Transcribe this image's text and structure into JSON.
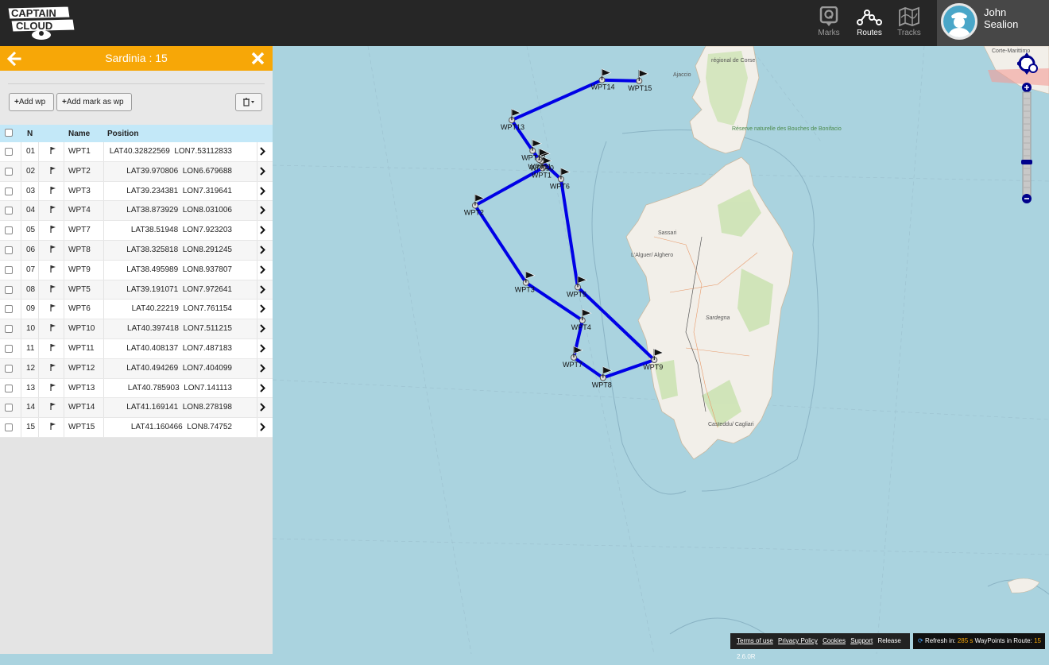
{
  "app": {
    "logo_text": "CAPTAIN CLOUD"
  },
  "nav": [
    {
      "id": "marks",
      "label": "Marks"
    },
    {
      "id": "routes",
      "label": "Routes"
    },
    {
      "id": "tracks",
      "label": "Tracks"
    }
  ],
  "user": {
    "first": "John",
    "last": "Sealion"
  },
  "panel": {
    "title": "Sardinia : 15",
    "add_wp_label": "Add wp",
    "add_mark_label": "Add mark as wp",
    "columns": {
      "n": "N",
      "name": "Name",
      "position": "Position"
    }
  },
  "waypoints": [
    {
      "n": "01",
      "name": "WPT1",
      "lat": "LAT40.32822569",
      "lon": "LON7.53112833"
    },
    {
      "n": "02",
      "name": "WPT2",
      "lat": "LAT39.970806",
      "lon": "LON6.679688"
    },
    {
      "n": "03",
      "name": "WPT3",
      "lat": "LAT39.234381",
      "lon": "LON7.319641"
    },
    {
      "n": "04",
      "name": "WPT4",
      "lat": "LAT38.873929",
      "lon": "LON8.031006"
    },
    {
      "n": "05",
      "name": "WPT7",
      "lat": "LAT38.51948",
      "lon": "LON7.923203"
    },
    {
      "n": "06",
      "name": "WPT8",
      "lat": "LAT38.325818",
      "lon": "LON8.291245"
    },
    {
      "n": "07",
      "name": "WPT9",
      "lat": "LAT38.495989",
      "lon": "LON8.937807"
    },
    {
      "n": "08",
      "name": "WPT5",
      "lat": "LAT39.191071",
      "lon": "LON7.972641"
    },
    {
      "n": "09",
      "name": "WPT6",
      "lat": "LAT40.22219",
      "lon": "LON7.761154"
    },
    {
      "n": "10",
      "name": "WPT10",
      "lat": "LAT40.397418",
      "lon": "LON7.511215"
    },
    {
      "n": "11",
      "name": "WPT11",
      "lat": "LAT40.408137",
      "lon": "LON7.487183"
    },
    {
      "n": "12",
      "name": "WPT12",
      "lat": "LAT40.494269",
      "lon": "LON7.404099"
    },
    {
      "n": "13",
      "name": "WPT13",
      "lat": "LAT40.785903",
      "lon": "LON7.141113"
    },
    {
      "n": "14",
      "name": "WPT14",
      "lat": "LAT41.169141",
      "lon": "LON8.278198"
    },
    {
      "n": "15",
      "name": "WPT15",
      "lat": "LAT41.160466",
      "lon": "LON8.74752"
    }
  ],
  "map_labels": {
    "corse": "régional de Corse",
    "ajaccio": "Ajaccio",
    "reserve": "Réserve naturelle des Bouches de Bonifacio",
    "sassari": "Sassari",
    "alghero": "L'Alguer/ Alghero",
    "sardegna": "Sardegna",
    "cagliari": "Casteddu/ Cagliari",
    "maritime": "Corte-Marittimo"
  },
  "footer": {
    "terms": "Terms of use",
    "privacy": "Privacy Policy",
    "cookies": "Cookies",
    "support": "Support",
    "release": "Release 2.6.0R",
    "refresh_prefix": "Refresh in:",
    "refresh_value": "285 s",
    "wp_prefix": "WayPoints in Route:",
    "wp_value": "15"
  },
  "colors": {
    "accent": "#f7a707",
    "route": "#0000e6",
    "header_row": "#c3e8f8"
  }
}
